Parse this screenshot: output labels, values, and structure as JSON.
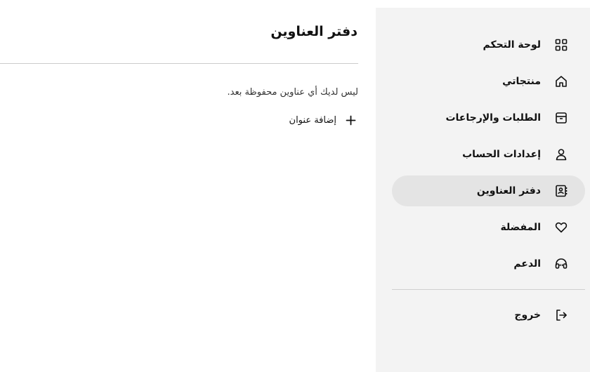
{
  "sidebar": {
    "items": [
      {
        "label": "لوحة التحكم",
        "icon": "grid-icon"
      },
      {
        "label": "منتجاتي",
        "icon": "home-icon"
      },
      {
        "label": "الطلبات والإرجاعات",
        "icon": "box-icon"
      },
      {
        "label": "إعدادات الحساب",
        "icon": "user-icon"
      },
      {
        "label": "دفتر العناوين",
        "icon": "address-book-icon",
        "active": true
      },
      {
        "label": "المفضلة",
        "icon": "heart-icon"
      },
      {
        "label": "الدعم",
        "icon": "headset-icon"
      }
    ],
    "logout": {
      "label": "خروج",
      "icon": "logout-icon"
    }
  },
  "main": {
    "title": "دفتر العناوين",
    "empty_message": "ليس لديك أي عناوين محفوظة بعد.",
    "add_button_label": "إضافة عنوان"
  }
}
